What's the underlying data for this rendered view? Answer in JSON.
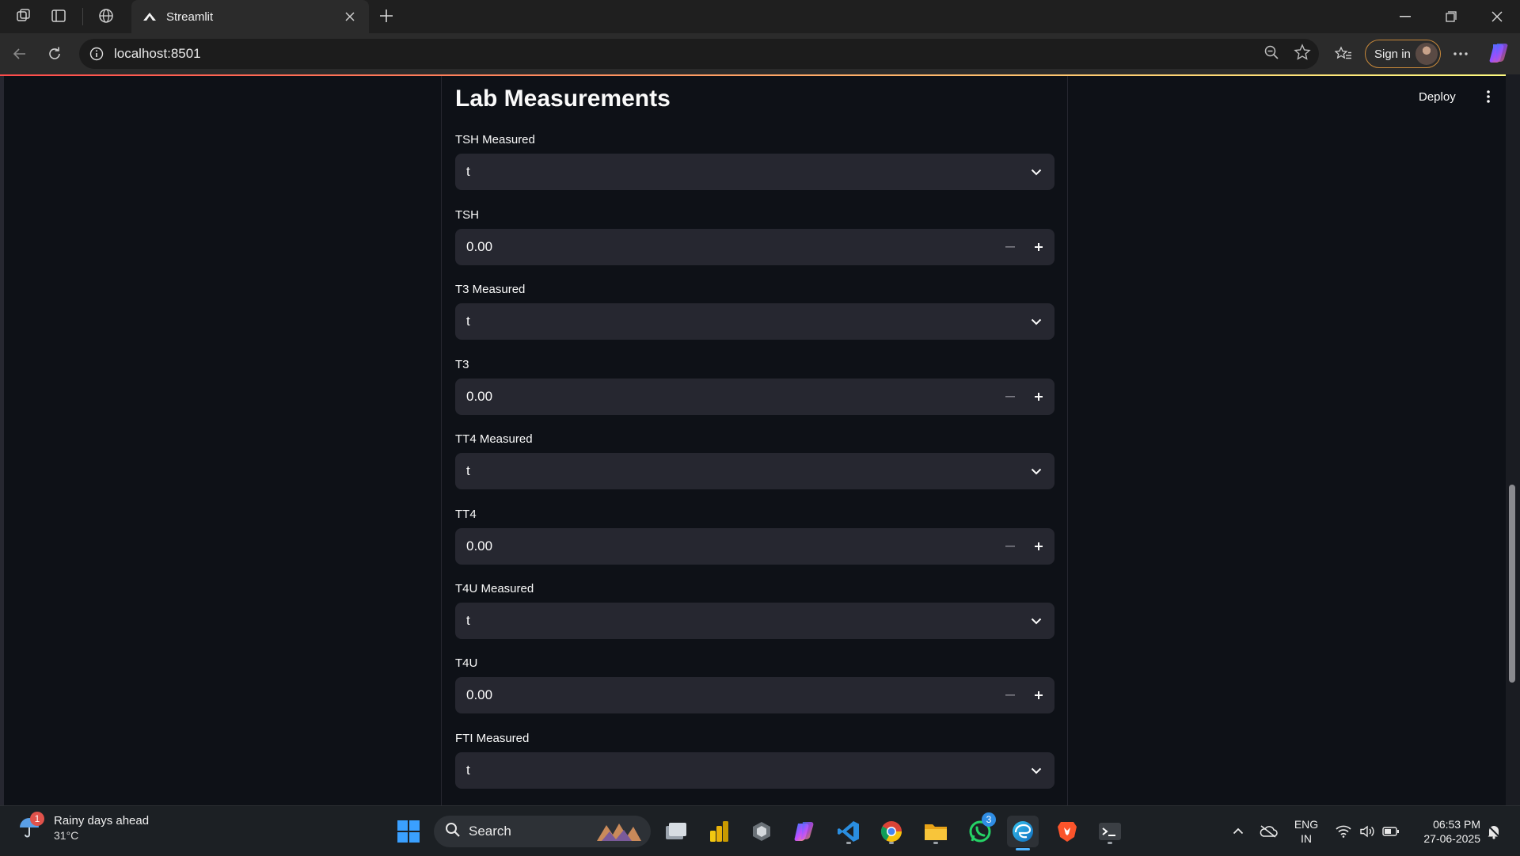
{
  "browser": {
    "tab_title": "Streamlit",
    "url": "localhost:8501",
    "sign_in_label": "Sign in"
  },
  "app": {
    "deploy_label": "Deploy",
    "heading": "Lab Measurements",
    "fields": [
      {
        "label": "TSH Measured",
        "type": "select",
        "value": "t"
      },
      {
        "label": "TSH",
        "type": "number",
        "value": "0.00"
      },
      {
        "label": "T3 Measured",
        "type": "select",
        "value": "t"
      },
      {
        "label": "T3",
        "type": "number",
        "value": "0.00"
      },
      {
        "label": "TT4 Measured",
        "type": "select",
        "value": "t"
      },
      {
        "label": "TT4",
        "type": "number",
        "value": "0.00"
      },
      {
        "label": "T4U Measured",
        "type": "select",
        "value": "t"
      },
      {
        "label": "T4U",
        "type": "number",
        "value": "0.00"
      },
      {
        "label": "FTI Measured",
        "type": "select",
        "value": "t"
      }
    ]
  },
  "taskbar": {
    "weather_title": "Rainy days ahead",
    "weather_temp": "31°C",
    "weather_badge": "1",
    "search_label": "Search",
    "whatsapp_badge": "3",
    "lang_top": "ENG",
    "lang_bottom": "IN",
    "time": "06:53 PM",
    "date": "27-06-2025"
  }
}
